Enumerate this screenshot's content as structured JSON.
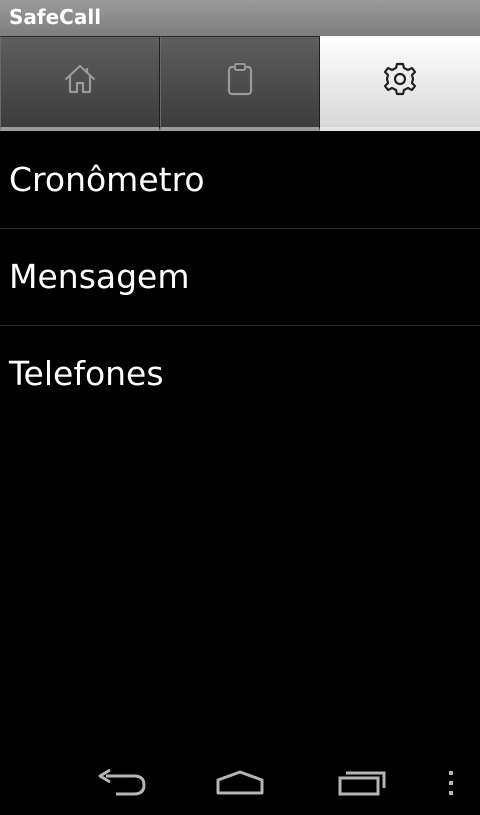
{
  "app": {
    "title": "SafeCall"
  },
  "tabs": [
    {
      "id": "home",
      "icon": "home-icon",
      "selected": false
    },
    {
      "id": "clipboard",
      "icon": "clipboard-icon",
      "selected": false
    },
    {
      "id": "settings",
      "icon": "gear-icon",
      "selected": true
    }
  ],
  "menu": {
    "items": [
      {
        "label": "Cronômetro"
      },
      {
        "label": "Mensagem"
      },
      {
        "label": "Telefones"
      }
    ]
  },
  "navbar": {
    "buttons": [
      {
        "icon": "back-icon"
      },
      {
        "icon": "home-nav-icon"
      },
      {
        "icon": "recent-apps-icon"
      },
      {
        "icon": "overflow-menu-icon"
      }
    ]
  },
  "colors": {
    "background": "#000000",
    "title_bar": "#8a8a8a",
    "tab_unselected": "#4a4a4a",
    "tab_selected": "#f0f0f0",
    "text": "#ffffff",
    "divider": "#2b2b2b"
  }
}
